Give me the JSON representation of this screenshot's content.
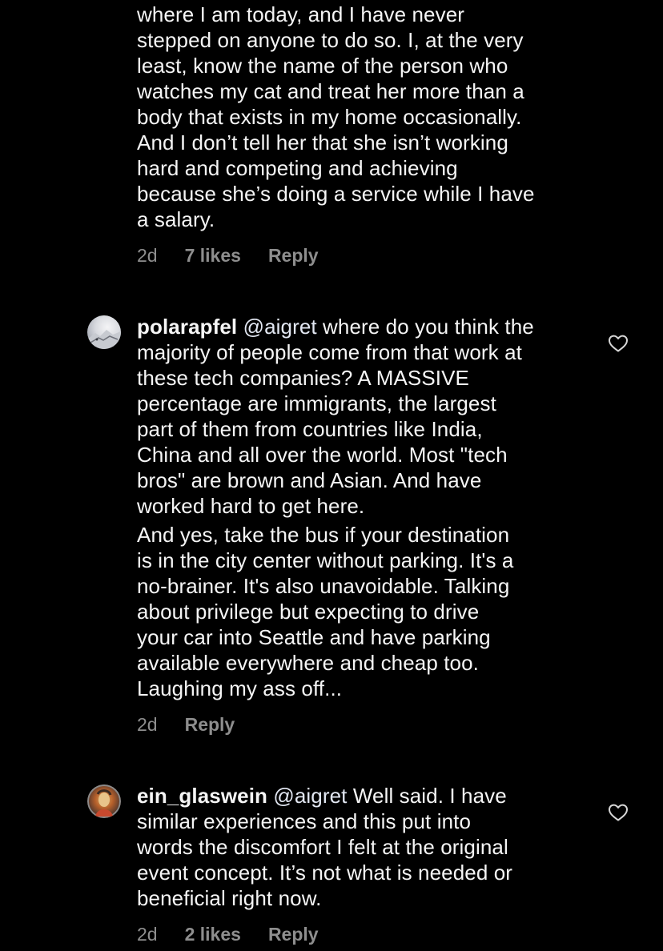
{
  "comments": [
    {
      "username": "",
      "mention": "",
      "lines": [
        "where I am today, and I have never",
        "stepped on anyone to do so. I, at the very",
        "least, know the name of the person who",
        "watches my cat and treat her more than a",
        "body that exists in my home occasionally.",
        "And I don’t tell her that she isn’t working",
        "hard and competing and achieving",
        "because she’s doing a service while I have",
        "a salary."
      ],
      "time": "2d",
      "likes": "7 likes",
      "reply": "Reply"
    },
    {
      "username": "polarapfel",
      "mention": "@aigret",
      "first_text": " where do you think the",
      "lines": [
        "majority of people come from that work at",
        "these tech companies? A MASSIVE",
        "percentage are immigrants, the largest",
        "part of them from countries like India,",
        "China and all over the world. Most \"tech",
        "bros\" are brown and Asian. And have",
        "worked hard to get here."
      ],
      "lines2": [
        "And yes, take the bus if your destination",
        "is in the city center without parking. It's a",
        "no-brainer. It's also unavoidable. Talking",
        "about privilege but expecting to drive",
        "your car into Seattle and have parking",
        "available everywhere and cheap too.",
        "Laughing my ass off..."
      ],
      "time": "2d",
      "reply": "Reply",
      "avatar_icon": "snow-landscape-avatar"
    },
    {
      "username": "ein_glaswein",
      "mention": "@aigret",
      "first_text": " Well said. I have",
      "lines": [
        "similar experiences and this put into",
        "words the discomfort I felt at the original",
        "event concept. It’s not what is needed or",
        "beneficial right now."
      ],
      "time": "2d",
      "likes": "2 likes",
      "reply": "Reply",
      "avatar_icon": "artwork-avatar"
    }
  ],
  "icons": {
    "like": "heart-outline-icon"
  },
  "colors": {
    "background": "#000000",
    "text": "#f5f5f5",
    "meta": "#8e8e8e"
  }
}
